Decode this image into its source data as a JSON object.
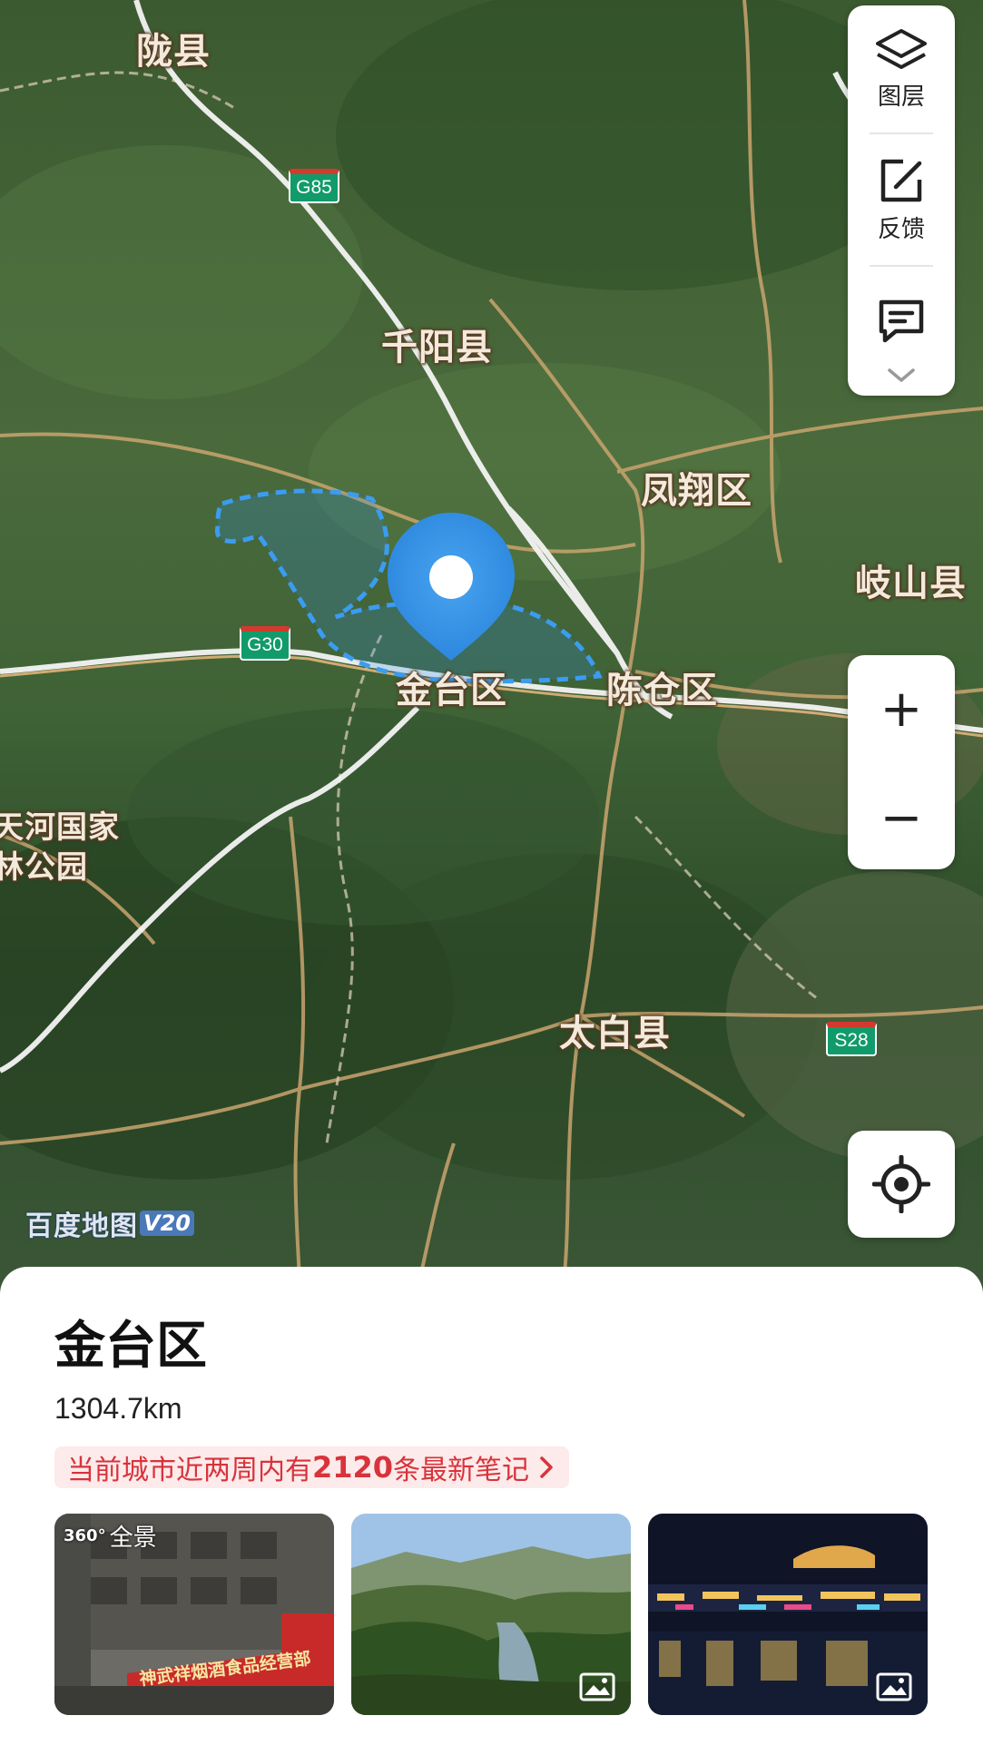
{
  "map": {
    "places": [
      {
        "id": "longxian",
        "label": "陇县"
      },
      {
        "id": "qianyang",
        "label": "千阳县"
      },
      {
        "id": "fengxiang",
        "label": "凤翔区"
      },
      {
        "id": "qishan",
        "label": "岐山县"
      },
      {
        "id": "jintai",
        "label": "金台区"
      },
      {
        "id": "chencang",
        "label": "陈仓区"
      },
      {
        "id": "tianhe1",
        "label": "天河国家"
      },
      {
        "id": "tianhe2",
        "label": "林公园"
      },
      {
        "id": "taibai",
        "label": "太白县"
      }
    ],
    "shields": [
      {
        "id": "g85",
        "label": "G85"
      },
      {
        "id": "g30",
        "label": "G30"
      },
      {
        "id": "s28",
        "label": "S28"
      }
    ],
    "brand": {
      "name": "百度地图",
      "version": "V20"
    }
  },
  "controls": {
    "layers_label": "图层",
    "feedback_label": "反馈",
    "zoom_in": "+",
    "zoom_out": "−"
  },
  "sheet": {
    "title": "金台区",
    "distance": "1304.7km",
    "notes_prefix": "当前城市近两周内有",
    "notes_count": "2120",
    "notes_suffix": "条最新笔记",
    "photos": [
      {
        "badge": "全景",
        "badge_prefix": "360°",
        "sign_text": "神武祥烟酒食品经营部"
      },
      {
        "type": "landscape"
      },
      {
        "type": "night"
      }
    ]
  },
  "colors": {
    "accent": "#2f8fe6",
    "notes_red": "#d8333b"
  }
}
